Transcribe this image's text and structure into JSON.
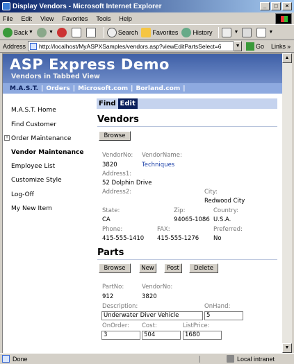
{
  "window": {
    "title": "Display Vendors - Microsoft Internet Explorer"
  },
  "menu": [
    "File",
    "Edit",
    "View",
    "Favorites",
    "Tools",
    "Help"
  ],
  "toolbar": {
    "back": "Back",
    "search": "Search",
    "favorites": "Favorites",
    "history": "History"
  },
  "address": {
    "label": "Address",
    "url": "http://localhost/MyASPXSamples/vendors.asp?viewEditPartsSelect=6",
    "go": "Go",
    "links": "Links"
  },
  "status": {
    "text": "Done",
    "zone": "Local intranet"
  },
  "banner": {
    "title": "ASP Express Demo",
    "subtitle": "Vendors in Tabbed View"
  },
  "topnav": [
    "M.A.S.T.",
    "Orders",
    "Microsoft.com",
    "Borland.com"
  ],
  "sidebar": [
    "M.A.S.T. Home",
    "Find Customer",
    "Order Maintenance",
    "Vendor Maintenance",
    "Employee List",
    "Customize Style",
    "Log-Off",
    "My New Item"
  ],
  "tabs": [
    "Find",
    "Edit"
  ],
  "vendors": {
    "title": "Vendors",
    "browse": "Browse",
    "labels": {
      "vendor_no": "VendorNo:",
      "vendor_name": "VendorName:",
      "address1": "Address1:",
      "address2": "Address2:",
      "city": "City:",
      "state": "State:",
      "zip": "Zip:",
      "country": "Country:",
      "phone": "Phone:",
      "fax": "FAX:",
      "preferred": "Preferred:"
    },
    "values": {
      "vendor_no": "3820",
      "vendor_name": "Techniques",
      "address1": "52 Dolphin Drive",
      "city": "Redwood City",
      "state": "CA",
      "zip": "94065-1086",
      "country": "U.S.A.",
      "phone": "415-555-1410",
      "fax": "415-555-1276",
      "preferred": "No"
    }
  },
  "parts": {
    "title": "Parts",
    "buttons": {
      "browse": "Browse",
      "new": "New",
      "post": "Post",
      "delete": "Delete"
    },
    "labels": {
      "part_no": "PartNo:",
      "vendor_no": "VendorNo:",
      "description": "Description:",
      "on_hand": "OnHand:",
      "on_order": "OnOrder:",
      "cost": "Cost:",
      "list_price": "ListPrice:"
    },
    "values": {
      "part_no": "912",
      "vendor_no": "3820",
      "description": "Underwater Diver Vehicle",
      "on_hand": "5",
      "on_order": "3",
      "cost": "504",
      "list_price": "1680"
    }
  }
}
